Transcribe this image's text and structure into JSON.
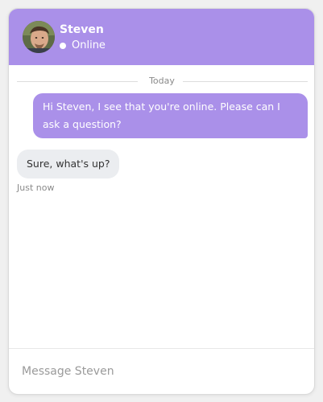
{
  "header": {
    "contact_name": "Steven",
    "status": "Online",
    "accent_color": "#aa90e9"
  },
  "messages": {
    "date_label": "Today",
    "outgoing": [
      {
        "text": "Hi Steven, I see that you're online. Please can I ask a question?"
      }
    ],
    "incoming": [
      {
        "text": "Sure, what's up?",
        "time": "Just now"
      }
    ]
  },
  "composer": {
    "placeholder": "Message Steven",
    "value": ""
  }
}
